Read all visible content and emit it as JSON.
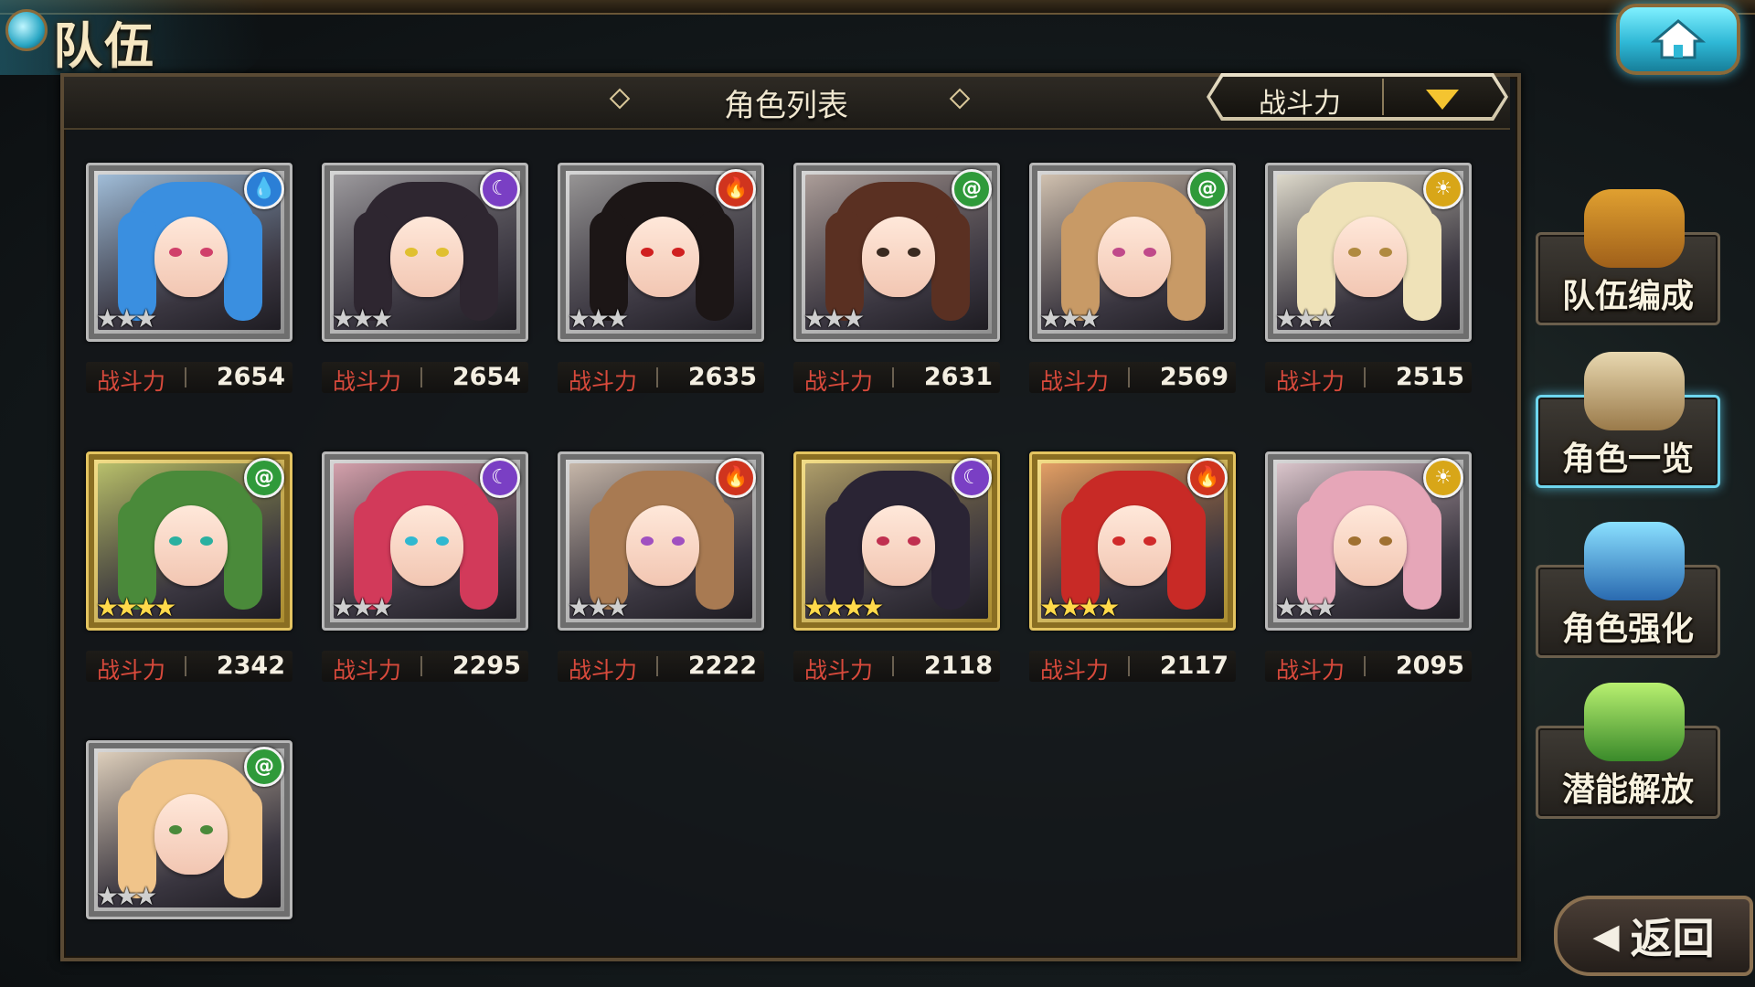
{
  "header": {
    "title": "队伍"
  },
  "list": {
    "title": "角色列表",
    "sort": {
      "selected": "战斗力"
    },
    "power_label": "战斗力"
  },
  "element_colors": {
    "water": "#2b7fd6",
    "dark": "#7a3fc4",
    "fire": "#d0341e",
    "wind": "#2f9a3a",
    "light": "#d8a618"
  },
  "characters": [
    {
      "element": "water",
      "element_icon": "water-drop-icon",
      "stars": 3,
      "frame": "silver",
      "power": "2654",
      "hair": "#3a8fe0",
      "eyes": "#d0406a"
    },
    {
      "element": "dark",
      "element_icon": "moon-icon",
      "stars": 3,
      "frame": "silver",
      "power": "2654",
      "hair": "#2e2630",
      "eyes": "#e0c030"
    },
    {
      "element": "fire",
      "element_icon": "flame-icon",
      "stars": 3,
      "frame": "silver",
      "power": "2635",
      "hair": "#1c1616",
      "eyes": "#d02020"
    },
    {
      "element": "wind",
      "element_icon": "wind-swirl-icon",
      "stars": 3,
      "frame": "silver",
      "power": "2631",
      "hair": "#5a3022",
      "eyes": "#3a2a20"
    },
    {
      "element": "wind",
      "element_icon": "wind-swirl-icon",
      "stars": 3,
      "frame": "silver",
      "power": "2569",
      "hair": "#c89a66",
      "eyes": "#c04a8a"
    },
    {
      "element": "light",
      "element_icon": "sun-icon",
      "stars": 3,
      "frame": "silver",
      "power": "2515",
      "hair": "#efe2b8",
      "eyes": "#b08a40"
    },
    {
      "element": "wind",
      "element_icon": "wind-swirl-icon",
      "stars": 4,
      "frame": "gold",
      "power": "2342",
      "hair": "#4a8a3a",
      "eyes": "#2ab0a0"
    },
    {
      "element": "dark",
      "element_icon": "moon-icon",
      "stars": 3,
      "frame": "silver",
      "power": "2295",
      "hair": "#d23a5a",
      "eyes": "#30b8d0"
    },
    {
      "element": "fire",
      "element_icon": "flame-icon",
      "stars": 3,
      "frame": "silver",
      "power": "2222",
      "hair": "#a87a52",
      "eyes": "#a050c0"
    },
    {
      "element": "dark",
      "element_icon": "moon-icon",
      "stars": 4,
      "frame": "gold",
      "power": "2118",
      "hair": "#2a2434",
      "eyes": "#c03050"
    },
    {
      "element": "fire",
      "element_icon": "flame-icon",
      "stars": 4,
      "frame": "gold",
      "power": "2117",
      "hair": "#c82a26",
      "eyes": "#d02a2a"
    },
    {
      "element": "light",
      "element_icon": "sun-icon",
      "stars": 3,
      "frame": "silver",
      "power": "2095",
      "hair": "#e6a6b8",
      "eyes": "#a07030"
    },
    {
      "element": "wind",
      "element_icon": "wind-swirl-icon",
      "stars": 3,
      "frame": "silver",
      "power": "",
      "hair": "#f0c48a",
      "eyes": "#4a8a3a"
    }
  ],
  "sidebar": {
    "items": [
      {
        "label": "队伍编成",
        "icon": "party-members-icon",
        "active": false
      },
      {
        "label": "角色一览",
        "icon": "open-book-icon",
        "active": true
      },
      {
        "label": "角色强化",
        "icon": "crystal-tome-icon",
        "active": false
      },
      {
        "label": "潜能解放",
        "icon": "potential-orb-icon",
        "active": false
      }
    ]
  },
  "back": {
    "label": "返回"
  }
}
